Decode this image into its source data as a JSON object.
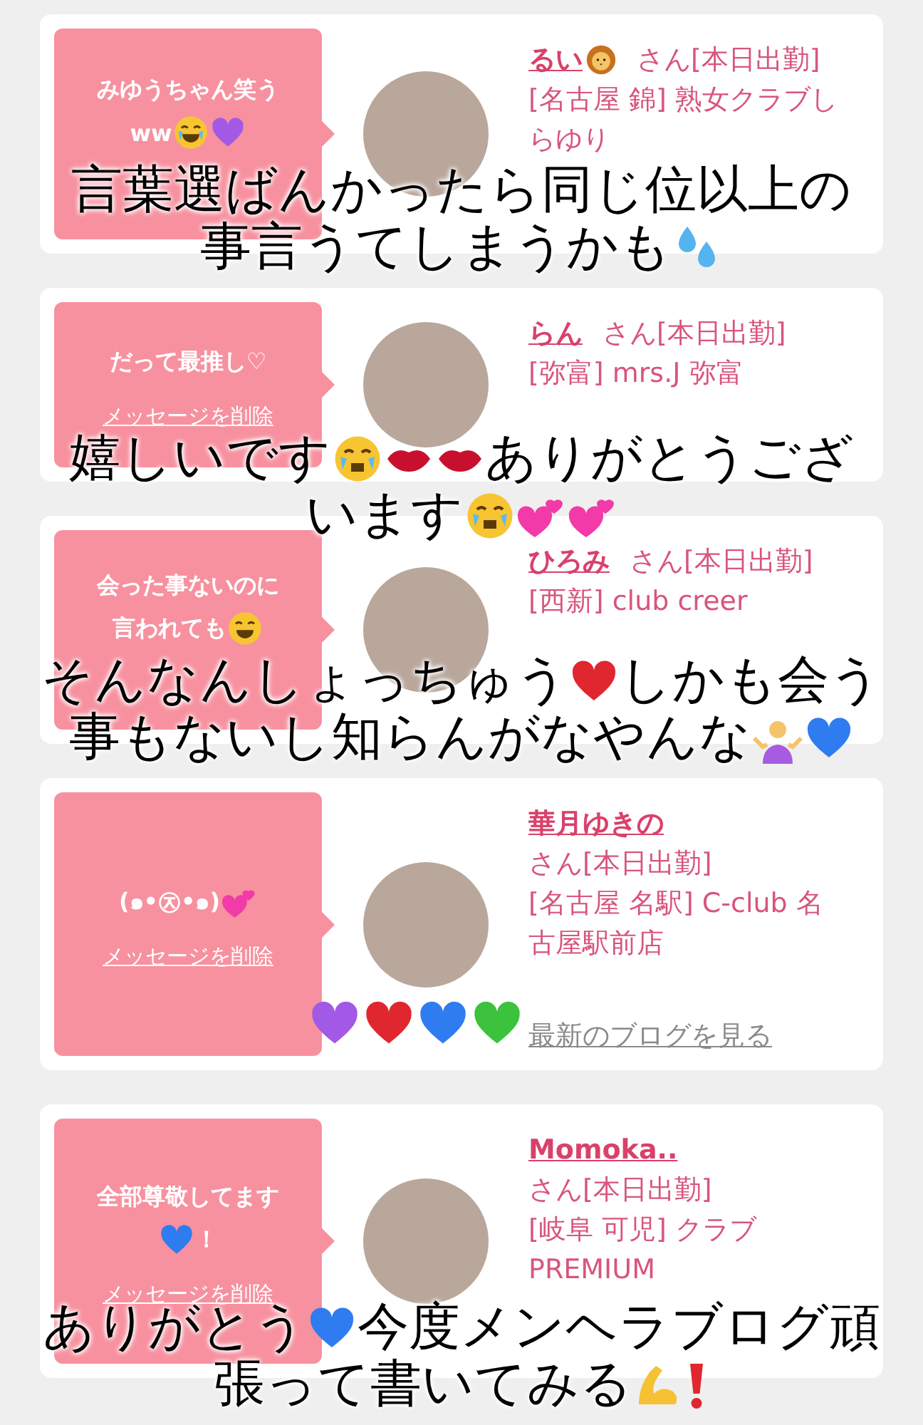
{
  "cards": [
    {
      "message": [
        [
          {
            "kind": "text",
            "text": "みゆうちゃん笑う"
          }
        ],
        [
          {
            "kind": "text",
            "text": "ww"
          },
          {
            "kind": "laughface"
          },
          {
            "kind": "heart",
            "color": "#a259e6"
          }
        ]
      ],
      "name": "るい",
      "name_badge": {
        "kind": "lion"
      },
      "suffix": "さん[本日出勤]",
      "shop": "[名古屋 錦] 熟女クラブしらゆり",
      "caption": [
        [
          {
            "kind": "text",
            "text": "言葉選ばんかったら同じ位以上の"
          }
        ],
        [
          {
            "kind": "text",
            "text": "事言うてしまうかも"
          },
          {
            "kind": "drops"
          }
        ]
      ]
    },
    {
      "message": [
        [
          {
            "kind": "text",
            "text": "だって最推し♡"
          }
        ]
      ],
      "delete_link": "メッセージを削除",
      "name": "らん",
      "suffix": "さん[本日出勤]",
      "shop": "[弥富] mrs.J 弥富",
      "caption": [
        [
          {
            "kind": "text",
            "text": "嬉しいです"
          },
          {
            "kind": "sobface"
          },
          {
            "kind": "lips"
          },
          {
            "kind": "lips"
          },
          {
            "kind": "text",
            "text": "ありがとうござ"
          }
        ],
        [
          {
            "kind": "text",
            "text": "います"
          },
          {
            "kind": "sobface"
          },
          {
            "kind": "twohearts"
          },
          {
            "kind": "twohearts"
          }
        ]
      ]
    },
    {
      "message": [
        [
          {
            "kind": "text",
            "text": "会った事ないのに"
          }
        ],
        [
          {
            "kind": "text",
            "text": "言われても"
          },
          {
            "kind": "roflface"
          }
        ]
      ],
      "name": "ひろみ",
      "suffix": "さん[本日出勤]",
      "shop": "[西新] club creer",
      "caption": [
        [
          {
            "kind": "text",
            "text": "そんなんしょっちゅう"
          },
          {
            "kind": "heart",
            "color": "#e0262f"
          },
          {
            "kind": "text",
            "text": "しかも会う"
          }
        ],
        [
          {
            "kind": "text",
            "text": "事もないし知らんがなやんな"
          },
          {
            "kind": "shrug"
          },
          {
            "kind": "heart",
            "color": "#2f7cf0"
          }
        ]
      ]
    },
    {
      "message": [
        [
          {
            "kind": "text",
            "text": "(๑•㉨•๑)"
          },
          {
            "kind": "twohearts"
          }
        ]
      ],
      "delete_link": "メッセージを削除",
      "name": "華月ゆきの",
      "suffix": "さん[本日出勤]",
      "shop": "[名古屋 名駅] C-club 名古屋駅前店",
      "blog_link": "最新のブログを見る",
      "caption": [
        [
          {
            "kind": "heart",
            "color": "#a259e6"
          },
          {
            "kind": "heart",
            "color": "#e0262f"
          },
          {
            "kind": "heart",
            "color": "#2f7cf0"
          },
          {
            "kind": "heart",
            "color": "#3cc23c"
          }
        ]
      ]
    },
    {
      "message": [
        [
          {
            "kind": "text",
            "text": "全部尊敬してます"
          }
        ],
        [
          {
            "kind": "heart",
            "color": "#2f7cf0"
          },
          {
            "kind": "text",
            "text": "！"
          }
        ]
      ],
      "delete_link": "メッセージを削除",
      "name": "Momoka..",
      "suffix": "さん[本日出勤]",
      "shop": "[岐阜 可児] クラブ PREMIUM",
      "caption": [
        [
          {
            "kind": "text",
            "text": "ありがとう"
          },
          {
            "kind": "heart",
            "color": "#2f7cf0"
          },
          {
            "kind": "text",
            "text": "今度メンヘラブログ頑"
          }
        ],
        [
          {
            "kind": "text",
            "text": "張って書いてみる"
          },
          {
            "kind": "muscle"
          },
          {
            "kind": "exclaim"
          }
        ]
      ]
    }
  ]
}
